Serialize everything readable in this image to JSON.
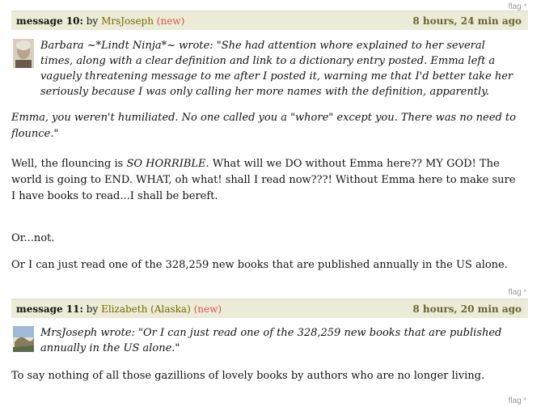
{
  "messages": [
    {
      "flag": "flag",
      "flag_star": "*",
      "label": "message 10:",
      "by": "by",
      "author": "MrsJoseph",
      "new_badge": "(new)",
      "time": "8 hours, 24 min ago",
      "avatar_icon": "user-avatar-photo",
      "quote": "Barbara ~*Lindt Ninja*~ wrote: \"She had attention whore explained to her several times, along with a clear definition and link to a dictionary entry posted. Emma left a vaguely threatening message to me after I posted it, warning me that I'd better take her seriously because I was only calling her more names with the definition, apparently.",
      "italic_para": "Emma, you weren't humiliated. No one called you a \"whore\" except you. There was no need to flounce.\"",
      "para1_before": "Well, the flouncing is ",
      "para1_em": "SO HORRIBLE",
      "para1_after": ". What will we DO without Emma here?? MY GOD! The world is going to END. WHAT, oh what! shall I read now???! Without Emma here to make sure I have books to read...I shall be bereft.",
      "para2": "Or...not.",
      "para3": "Or I can just read one of the 328,259 new books that are published annually in the US alone."
    },
    {
      "flag": "flag",
      "flag_star": "*",
      "label": "message 11:",
      "by": "by",
      "author": "Elizabeth (Alaska)",
      "new_badge": "(new)",
      "time": "8 hours, 20 min ago",
      "avatar_icon": "user-avatar-landscape",
      "quote": "MrsJoseph wrote: \"Or I can just read one of the 328,259 new books that are published annually in the US alone.\"",
      "para1": "To say nothing of all those gazillions of lovely books by authors who are no longer living."
    },
    {
      "flag": "flag",
      "flag_star": "*"
    }
  ]
}
